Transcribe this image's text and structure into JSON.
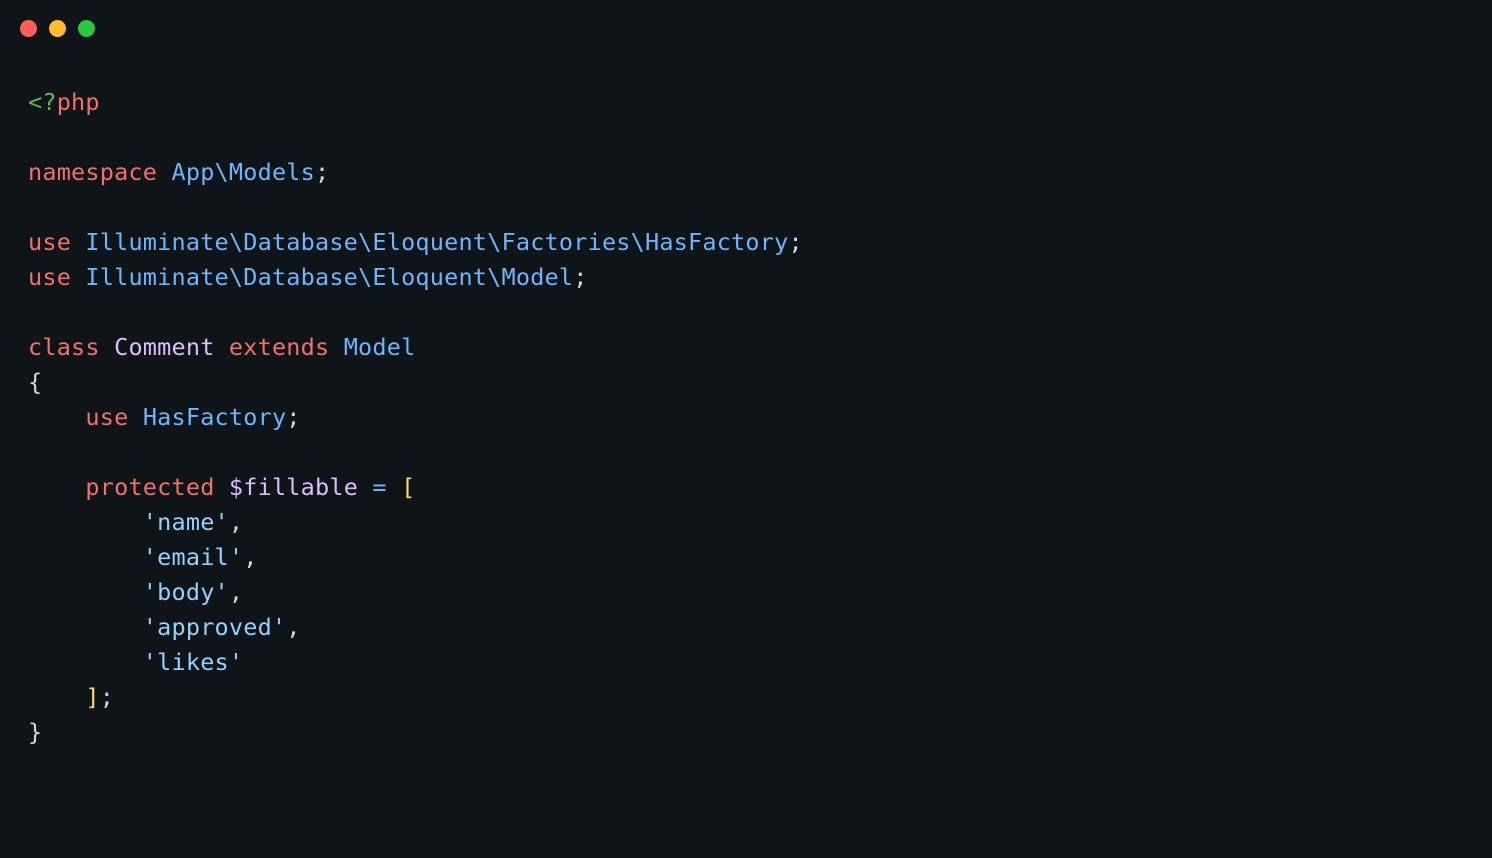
{
  "titlebar": {
    "dots": [
      "close",
      "minimize",
      "maximize"
    ]
  },
  "code": {
    "line1": {
      "open": "<?",
      "tag": "php"
    },
    "line3": {
      "kw": "namespace",
      "ns1": "App",
      "sep": "\\",
      "ns2": "Models",
      "end": ";"
    },
    "line5": {
      "kw": "use",
      "ns": "Illuminate\\Database\\Eloquent\\Factories\\HasFactory",
      "end": ";"
    },
    "line6": {
      "kw": "use",
      "ns": "Illuminate\\Database\\Eloquent\\Model",
      "end": ";"
    },
    "line8": {
      "kw_class": "class",
      "name": "Comment",
      "kw_extends": "extends",
      "parent": "Model"
    },
    "line9": {
      "brace": "{"
    },
    "line10": {
      "kw": "use",
      "trait": "HasFactory",
      "end": ";"
    },
    "line12": {
      "mod": "protected",
      "var": "$fillable",
      "eq": "=",
      "lbracket": "["
    },
    "line13": {
      "str": "'name'",
      "comma": ","
    },
    "line14": {
      "str": "'email'",
      "comma": ","
    },
    "line15": {
      "str": "'body'",
      "comma": ","
    },
    "line16": {
      "str": "'approved'",
      "comma": ","
    },
    "line17": {
      "str": "'likes'"
    },
    "line18": {
      "rbracket": "]",
      "end": ";"
    },
    "line19": {
      "brace": "}"
    }
  }
}
